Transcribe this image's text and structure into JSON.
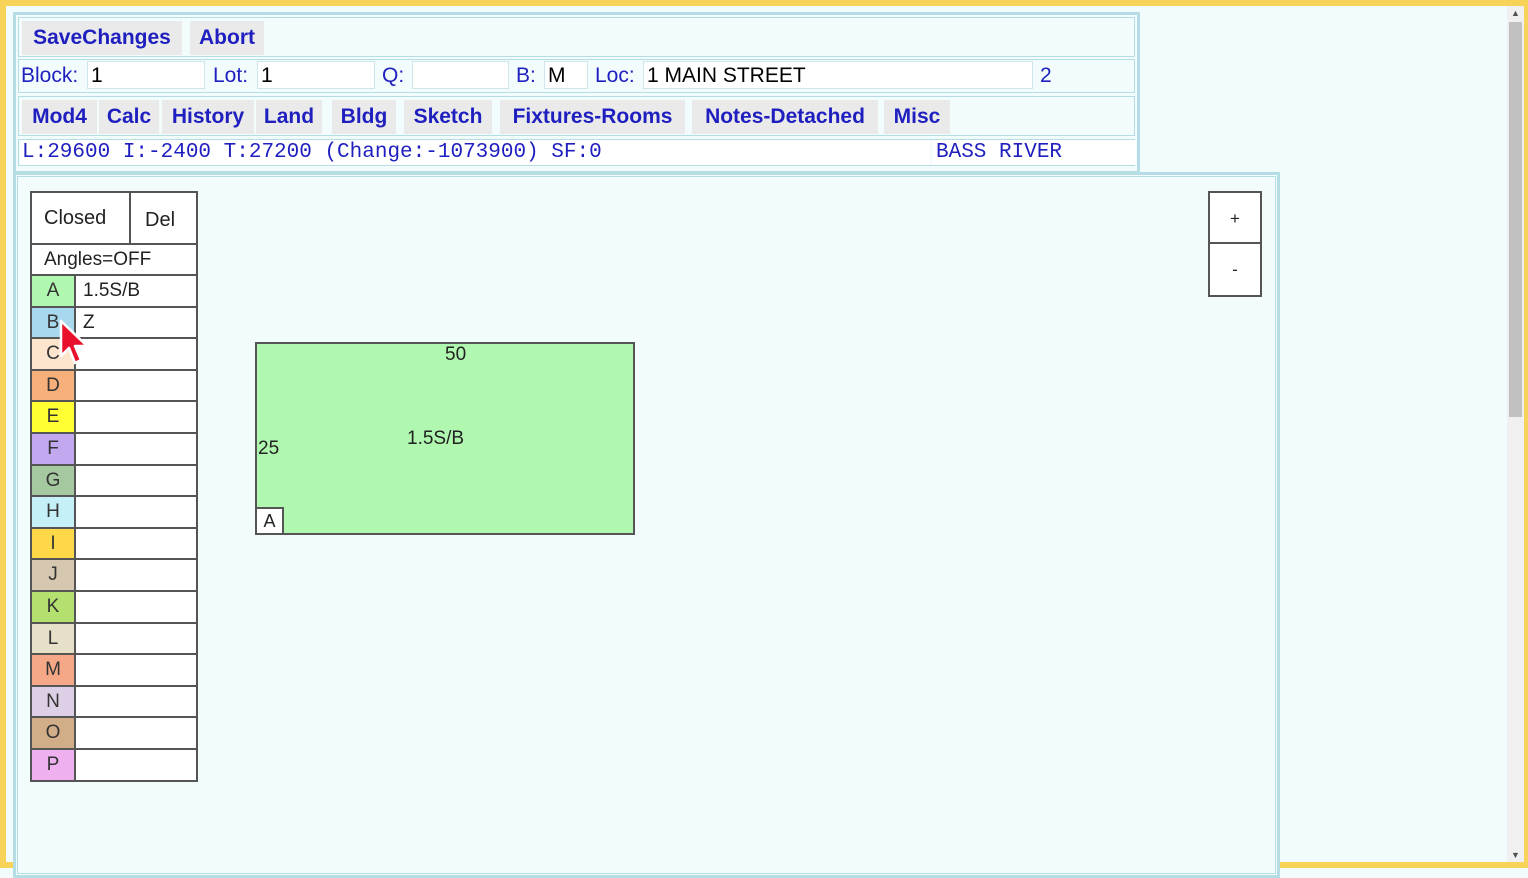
{
  "toolbar": {
    "save_label": "SaveChanges",
    "abort_label": "Abort"
  },
  "parcel": {
    "block_label": "Block:",
    "block_value": "1",
    "lot_label": "Lot:",
    "lot_value": "1",
    "q_label": "Q:",
    "q_value": "",
    "b_label": "B:",
    "b_value": "M",
    "loc_label": "Loc:",
    "loc_value": "1 MAIN STREET",
    "card": "2"
  },
  "tabs": [
    "Mod4",
    "Calc",
    "History",
    "Land",
    "Bldg",
    "Sketch",
    "Fixtures-Rooms",
    "Notes-Detached",
    "Misc"
  ],
  "status": {
    "values": "L:29600 I:-2400 T:27200 (Change:-1073900) SF:0",
    "town": "BASS RIVER"
  },
  "legend": {
    "closed_label": "Closed",
    "del_label": "Del",
    "angles_label": "Angles=OFF",
    "rows": [
      {
        "code": "A",
        "desc": "1.5S/B",
        "color": "#b0f8b0"
      },
      {
        "code": "B",
        "desc": "Z",
        "color": "#a8d8ee"
      },
      {
        "code": "C",
        "desc": "",
        "color": "#fde4cc"
      },
      {
        "code": "D",
        "desc": "",
        "color": "#f7b07a"
      },
      {
        "code": "E",
        "desc": "",
        "color": "#ffff33"
      },
      {
        "code": "F",
        "desc": "",
        "color": "#c2a8ee"
      },
      {
        "code": "G",
        "desc": "",
        "color": "#a6c8a0"
      },
      {
        "code": "H",
        "desc": "",
        "color": "#c6f0f8"
      },
      {
        "code": "I",
        "desc": "",
        "color": "#ffd84a"
      },
      {
        "code": "J",
        "desc": "",
        "color": "#d6c8b0"
      },
      {
        "code": "K",
        "desc": "",
        "color": "#b4e070"
      },
      {
        "code": "L",
        "desc": "",
        "color": "#e6e0c8"
      },
      {
        "code": "M",
        "desc": "",
        "color": "#f4a888"
      },
      {
        "code": "N",
        "desc": "",
        "color": "#ddd0e6"
      },
      {
        "code": "O",
        "desc": "",
        "color": "#d2ae88"
      },
      {
        "code": "P",
        "desc": "",
        "color": "#eeb0ee"
      }
    ]
  },
  "zoom": {
    "in_label": "+",
    "out_label": "-"
  },
  "sketch": {
    "width_label": "50",
    "height_label": "25",
    "area_label": "1.5S/B",
    "corner_tag": "A"
  }
}
